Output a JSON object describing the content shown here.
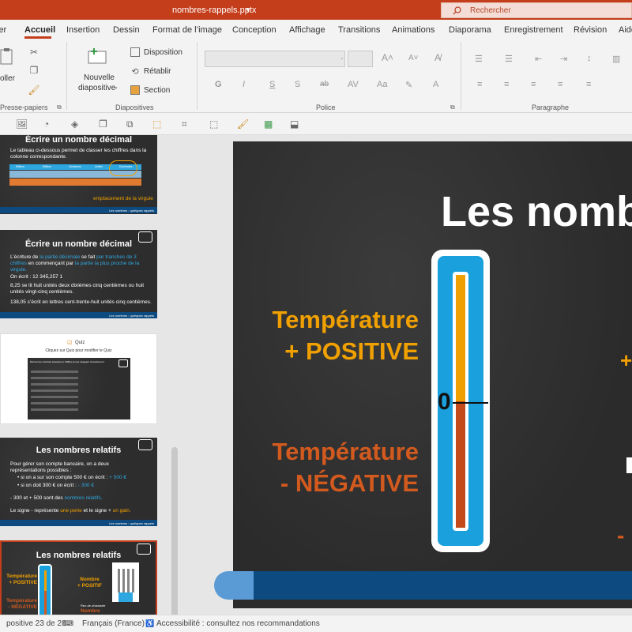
{
  "title_bar": {
    "doc_title": "nombres-rappels.pptx",
    "search_placeholder": "Rechercher"
  },
  "ribbon_tabs": [
    {
      "label": "ier"
    },
    {
      "label": "Accueil"
    },
    {
      "label": "Insertion"
    },
    {
      "label": "Dessin"
    },
    {
      "label": "Format de l’image"
    },
    {
      "label": "Conception"
    },
    {
      "label": "Affichage"
    },
    {
      "label": "Transitions"
    },
    {
      "label": "Animations"
    },
    {
      "label": "Diaporama"
    },
    {
      "label": "Enregistrement"
    },
    {
      "label": "Révision"
    },
    {
      "label": "Aide"
    }
  ],
  "ribbon": {
    "paste_label": "oller",
    "clipboard_group": "Presse-papiers",
    "new_slide_label_1": "Nouvelle",
    "new_slide_label_2": "diapositive",
    "layout_label": "Disposition",
    "reset_label": "Rétablir",
    "section_label": "Section",
    "slides_group": "Diapositives",
    "font_group": "Police",
    "paragraph_group": "Paragraphe"
  },
  "colors": {
    "accent": "#c43e1c",
    "chalk": "#2d2d2d",
    "orange": "#f0a000",
    "red_orange": "#d35a1e",
    "blue": "#2ea7e0",
    "dark_blue": "#0c4a80"
  },
  "thumbnails": {
    "t1": {
      "title": "Écrire un nombre décimal",
      "text": "Le tableau ci-dessous permet de classer les chiffres dans la colonne correspondante.",
      "cols": [
        "Milliers",
        "Milliers",
        "Centaines",
        "Unités",
        "Décimales"
      ],
      "note": "emplacement de la virgule",
      "footer": "Les nombres : quelques rappels"
    },
    "t2": {
      "title": "Écrire un nombre décimal",
      "text_a": "L’écriture de",
      "text_b": "la partie décimale",
      "text_c": "se fait",
      "text_d": "par tranches de 3 chiffres",
      "text_e": "en commençant par",
      "text_f": "la partie la plus proche de la virgule.",
      "ex1": "On écrit : 12 345,257 1",
      "ex2": "8,25 se lit huit unités deux dixièmes cinq centièmes ou huit unités vingt-cinq centièmes.",
      "ex3": "138,05 s’écrit en lettres cent-trente-huit unités cinq centièmes.",
      "footer": "Les nombres : quelques rappels"
    },
    "t3": {
      "quiz": "Quiz",
      "instruction": "Cliquez sur Quiz pour modifier le Quiz",
      "inner_title": "Écrivez les nombres suivants en chiffres en les rangeant correctement :"
    },
    "t4": {
      "title": "Les nombres relatifs",
      "intro": "Pour gérer son compte bancaire, on a deux représentations possibles :",
      "b1a": "si on a sur son compte 500 € on écrit :",
      "b1b": "+ 500 €",
      "b2a": "si on doit 300 € on écrit :",
      "b2b": "- 300 €",
      "l3a": "- 300 et + 500 sont des",
      "l3b": "nombres relatifs.",
      "l4a": "Le signe - représente",
      "l4b": "une perte",
      "l4c": "et le signe +",
      "l4d": "un gain.",
      "footer": "Les nombres : quelques rappels"
    },
    "t5": {
      "title": "Les nombres relatifs",
      "temp_pos_1": "Température",
      "temp_pos_2": "+ POSITIVE",
      "temp_neg_1": "Température",
      "temp_neg_2": "- NÉGATIVE",
      "nombre_pos_1": "Nombre",
      "nombre_pos_2": "+ POSITIF",
      "nombre_neg": "Nombre",
      "rdc": "Rez-de-chaussée"
    }
  },
  "slide": {
    "title": "Les nombres",
    "temp_pos_line1": "Température",
    "temp_pos_line2": "+ POSITIVE",
    "temp_neg_line1": "Température",
    "temp_neg_line2": "- NÉGATIVE",
    "zero": "0",
    "right_plus": "+",
    "right_minus": "-"
  },
  "status": {
    "slide_info": "positive 23 de 28",
    "language": "Français (France)",
    "accessibility": "Accessibilité : consultez nos recommandations"
  }
}
